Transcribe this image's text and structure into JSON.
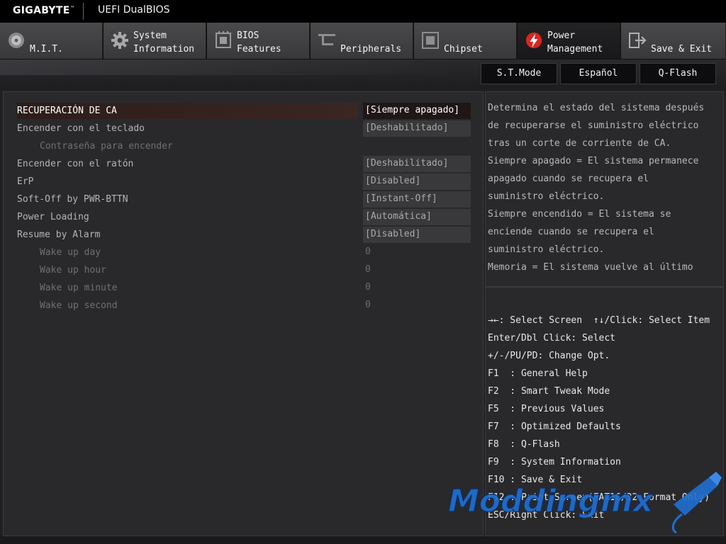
{
  "titlebar": {
    "brand": "GIGABYTE",
    "trademark": "™",
    "title": "UEFI DualBIOS"
  },
  "tabs": [
    {
      "icon": "disc-icon",
      "line1": "",
      "line2": "M.I.T.",
      "active": false
    },
    {
      "icon": "gear-icon",
      "line1": "System",
      "line2": "Information",
      "active": false
    },
    {
      "icon": "chip-icon",
      "line1": "BIOS",
      "line2": "Features",
      "active": false
    },
    {
      "icon": "peripherals-icon",
      "line1": "",
      "line2": "Peripherals",
      "active": false
    },
    {
      "icon": "chipset-icon",
      "line1": "",
      "line2": "Chipset",
      "active": false
    },
    {
      "icon": "power-icon",
      "line1": "Power",
      "line2": "Management",
      "active": true
    },
    {
      "icon": "exit-icon",
      "line1": "Save & Exit",
      "line2": "",
      "active": false
    }
  ],
  "mode_buttons": {
    "st_mode": "S.T.Mode",
    "language": "Español",
    "qflash": "Q-Flash"
  },
  "settings": [
    {
      "label": "RECUPERACIÓN DE CA",
      "value": "[Siempre apagado]",
      "selected": true,
      "sub": false,
      "plain": false
    },
    {
      "label": "Encender con el teclado",
      "value": "[Deshabilitado]",
      "selected": false,
      "sub": false,
      "plain": false
    },
    {
      "label": "Contraseña para encender",
      "value": "",
      "selected": false,
      "sub": true,
      "plain": true
    },
    {
      "label": "Encender con el ratón",
      "value": "[Deshabilitado]",
      "selected": false,
      "sub": false,
      "plain": false
    },
    {
      "label": "ErP",
      "value": "[Disabled]",
      "selected": false,
      "sub": false,
      "plain": false
    },
    {
      "label": "Soft-Off by PWR-BTTN",
      "value": "[Instant-Off]",
      "selected": false,
      "sub": false,
      "plain": false
    },
    {
      "label": "Power Loading",
      "value": "[Automática]",
      "selected": false,
      "sub": false,
      "plain": false
    },
    {
      "label": "Resume by Alarm",
      "value": "[Disabled]",
      "selected": false,
      "sub": false,
      "plain": false
    },
    {
      "label": "Wake up day",
      "value": "0",
      "selected": false,
      "sub": true,
      "plain": true
    },
    {
      "label": "Wake up hour",
      "value": "0",
      "selected": false,
      "sub": true,
      "plain": true
    },
    {
      "label": "Wake up minute",
      "value": "0",
      "selected": false,
      "sub": true,
      "plain": true
    },
    {
      "label": "Wake up second",
      "value": "0",
      "selected": false,
      "sub": true,
      "plain": true
    }
  ],
  "help": [
    "Determina el estado del sistema después",
    "de recuperarse el suministro eléctrico",
    "tras un corte de corriente de CA.",
    "Siempre apagado = El sistema permanece",
    "apagado cuando se recupera el",
    "suministro eléctrico.",
    "Siempre encendido = El sistema se",
    "enciende cuando se recupera el",
    "suministro eléctrico.",
    "Memoria = El sistema vuelve al último"
  ],
  "keys": [
    "→←: Select Screen  ↑↓/Click: Select Item",
    "Enter/Dbl Click: Select",
    "+/-/PU/PD: Change Opt.",
    "F1  : General Help",
    "F2  : Smart Tweak Mode",
    "F5  : Previous Values",
    "F7  : Optimized Defaults",
    "F8  : Q-Flash",
    "F9  : System Information",
    "F10 : Save & Exit",
    "F12 : Print Screen(FAT16/32 Format Only)",
    "ESC/Right Click: Exit"
  ],
  "watermark": {
    "text": "Moddingmx"
  },
  "colors": {
    "accent_red": "#d8261f",
    "watermark_blue": "#1f6fd1"
  }
}
